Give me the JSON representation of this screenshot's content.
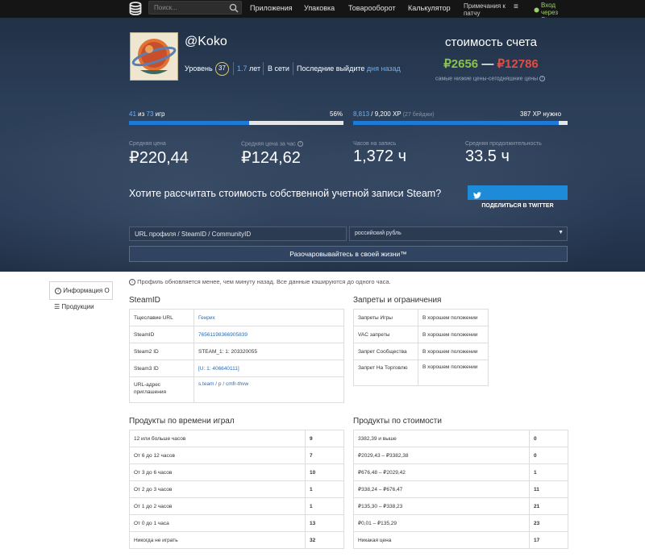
{
  "nav": {
    "logo_icon": "database-stack-icon",
    "search_placeholder": "Поиск...",
    "items": [
      "Приложения",
      "Упаковка",
      "Товарооборот",
      "Калькулятор"
    ],
    "notes": "Примечания к патчу",
    "menu_icon": "≡",
    "login": "Вход через Steam"
  },
  "profile": {
    "name": "@Koko",
    "level_label": "Уровень",
    "level": "37",
    "years": "1.7",
    "years_label": "лет",
    "status": "В сети",
    "last_seen_label": "Последние выйдите",
    "last_seen": "дня назад"
  },
  "valuation": {
    "title": "стоимость счета",
    "low": "₽2656",
    "dash": "—",
    "high": "₽12786",
    "note": "самые низкие цены-сегодняшние цены",
    "low_color": "#89c24f",
    "high_color": "#e34b43"
  },
  "progress": {
    "games_owned": "41",
    "games_of": "из",
    "games_total": "73",
    "games_unit": "игр",
    "games_percent": "56%",
    "games_fraction": 0.56,
    "xp_current": "8,813",
    "xp_total": "/ 9,200 XP",
    "xp_badges": "(27 бейджи)",
    "xp_needed": "387 XP нужно",
    "xp_fraction": 0.958
  },
  "kpis": [
    {
      "label": "Средняя цена",
      "value": "₽220,44"
    },
    {
      "label": "Средняя цена за час",
      "value": "₽124,62"
    },
    {
      "label": "Часов на запись",
      "value": "1,372 ч"
    },
    {
      "label": "Средняя продолжительность",
      "value": "33.5 ч"
    }
  ],
  "calc": {
    "question": "Хотите рассчитать стоимость собственной учетной записи Steam?",
    "share_label": "ПОДЕЛИТЬСЯ В TWITTER",
    "url_placeholder": "URL профиля / SteamID / CommunityID",
    "currency": "российский рубль",
    "button": "Разочаровывайтесь в своей жизни™",
    "twitter_color": "#1d8bd8"
  },
  "sidebar": {
    "info_tab": "Информация О",
    "products_tab": "Продукции"
  },
  "notice": "Профиль обновляется менее, чем минуту назад. Все данные кэшируются до одного часа.",
  "steamid": {
    "title": "SteamID",
    "rows": [
      {
        "label": "Тщеславие URL",
        "value": "Генрих"
      },
      {
        "label": "SteamID",
        "value": "76561198366905839"
      },
      {
        "label": "Steam2 ID",
        "value": "STEAM_1: 1: 203320055"
      },
      {
        "label": "Steam3 ID",
        "value": "[U: 1: 406640111]"
      },
      {
        "label": "URL-адрес приглашения",
        "value": "s.team / p / cmfr-thvw"
      }
    ]
  },
  "bans": {
    "title": "Запреты и ограничения",
    "rows": [
      {
        "label": "Запреты Игры",
        "value": "В хорошем положении"
      },
      {
        "label": "VAC запреты",
        "value": "В хорошем положении"
      },
      {
        "label": "Запрет Сообщества",
        "value": "В хорошем положении"
      },
      {
        "label": "Запрет На Торговлю",
        "value": "В хорошем положении"
      }
    ]
  },
  "by_playtime": {
    "title": "Продукты по времени играл",
    "rows": [
      {
        "label": "12 или больше часов",
        "value": "9"
      },
      {
        "label": "От 6 до 12 часов",
        "value": "7"
      },
      {
        "label": "От 3 до 6 часов",
        "value": "10"
      },
      {
        "label": "От 2 до 3 часов",
        "value": "1"
      },
      {
        "label": "От 1 до 2 часов",
        "value": "1"
      },
      {
        "label": "От 0 до 1 часа",
        "value": "13"
      },
      {
        "label": "Никогда не играть",
        "value": "32"
      }
    ]
  },
  "by_price": {
    "title": "Продукты по стоимости",
    "rows": [
      {
        "label": "3382,39 и выше",
        "value": "0"
      },
      {
        "label": "₽2029,43 – ₽3382,38",
        "value": "0"
      },
      {
        "label": "₽676,48 – ₽2029,42",
        "value": "1"
      },
      {
        "label": "₽338,24 – ₽676,47",
        "value": "11"
      },
      {
        "label": "₽135,30 – ₽338,23",
        "value": "21"
      },
      {
        "label": "₽0,01 – ₽135,29",
        "value": "23"
      },
      {
        "label": "Никакая цена",
        "value": "17"
      }
    ]
  }
}
